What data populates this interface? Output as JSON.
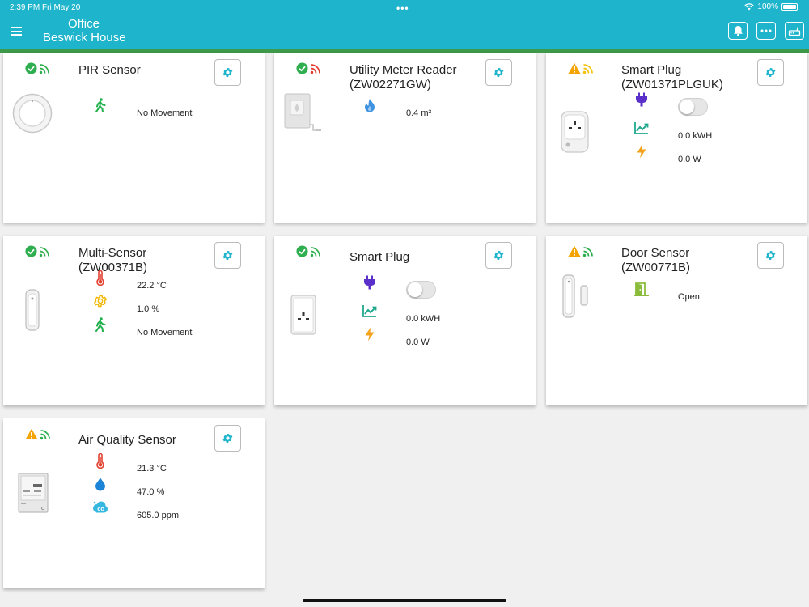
{
  "status_bar": {
    "time": "2:39 PM  Fri May 20",
    "dots": "•••",
    "battery": "100%"
  },
  "header": {
    "room": "Office",
    "site": "Beswick House"
  },
  "colors": {
    "accent": "#1eb4cb",
    "stripe": "#3c9a4a",
    "ok": "#2eae4e",
    "warn": "#f4a300"
  },
  "cards": [
    {
      "title": "PIR Sensor",
      "status_icon": "check-circle-icon",
      "signal_color": "#2eae4e",
      "readings": [
        {
          "icon": "walking-person-icon",
          "value": "No Movement"
        }
      ]
    },
    {
      "title": "Utility Meter Reader\n(ZW02271GW)",
      "status_icon": "check-circle-icon",
      "signal_color": "#e33b2e",
      "readings": [
        {
          "icon": "gas-flame-icon",
          "value": "0.4 m³"
        }
      ]
    },
    {
      "title": "Smart Plug\n(ZW01371PLGUK)",
      "status_icon": "warning-triangle-icon",
      "signal_color": "#f4c20d",
      "readings": [
        {
          "icon": "plug-icon",
          "value": ""
        },
        {
          "icon": "energy-chart-icon",
          "value": "0.0 kWH"
        },
        {
          "icon": "lightning-icon",
          "value": "0.0 W"
        }
      ]
    },
    {
      "title": "Multi-Sensor\n(ZW00371B)",
      "status_icon": "check-circle-icon",
      "signal_color": "#2eae4e",
      "readings": [
        {
          "icon": "thermometer-icon",
          "value": "22.2 °C"
        },
        {
          "icon": "sun-icon",
          "value": "1.0 %"
        },
        {
          "icon": "walking-person-icon",
          "value": "No Movement"
        }
      ]
    },
    {
      "title": "Smart Plug",
      "status_icon": "check-circle-icon",
      "signal_color": "#2eae4e",
      "readings": [
        {
          "icon": "plug-icon",
          "value": ""
        },
        {
          "icon": "energy-chart-icon",
          "value": "0.0 kWH"
        },
        {
          "icon": "lightning-icon",
          "value": "0.0 W"
        }
      ]
    },
    {
      "title": "Door Sensor\n(ZW00771B)",
      "status_icon": "warning-triangle-icon",
      "signal_color": "#2eae4e",
      "readings": [
        {
          "icon": "open-door-icon",
          "value": "Open"
        }
      ]
    },
    {
      "title": "Air Quality Sensor",
      "status_icon": "warning-triangle-icon",
      "signal_color": "#2eae4e",
      "readings": [
        {
          "icon": "thermometer-icon",
          "value": "21.3 °C"
        },
        {
          "icon": "water-drop-icon",
          "value": "47.0 %"
        },
        {
          "icon": "co2-cloud-icon",
          "value": "605.0 ppm"
        }
      ]
    }
  ]
}
